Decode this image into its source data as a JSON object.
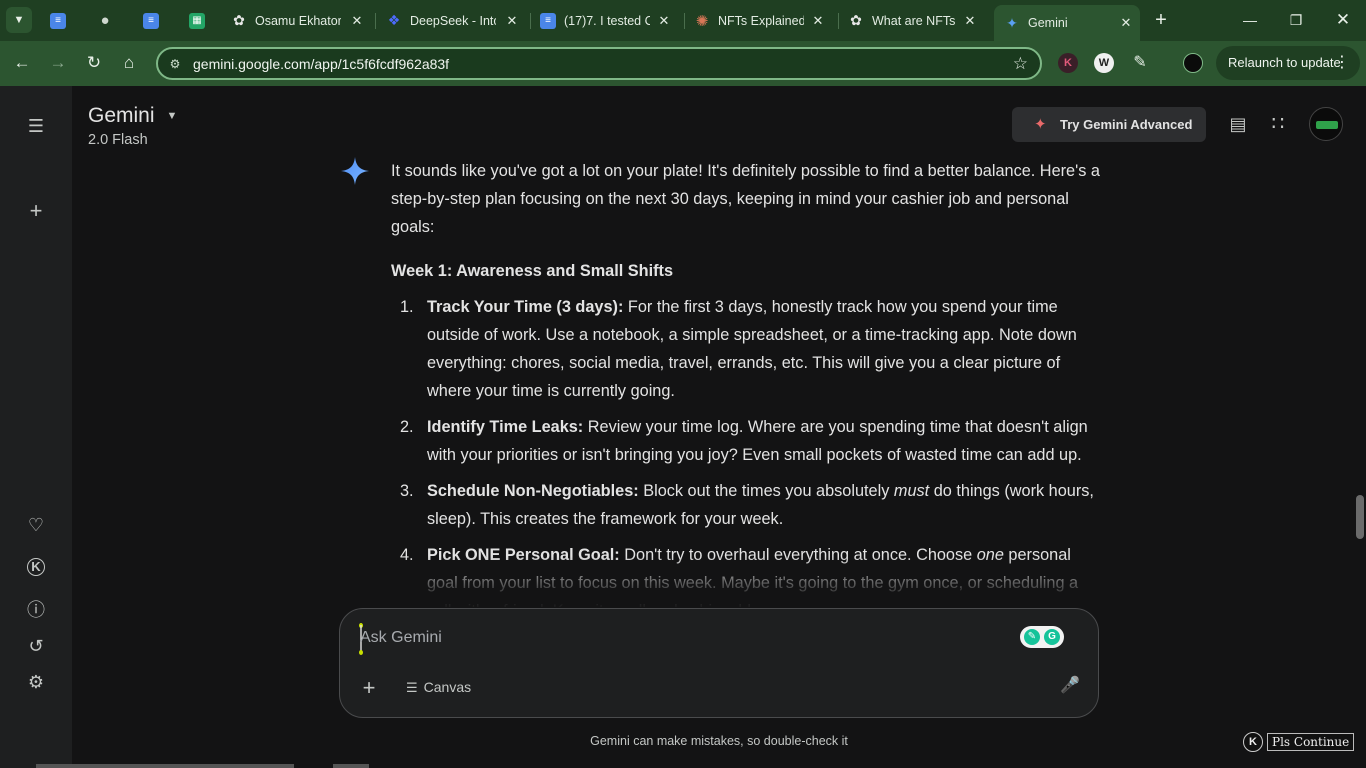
{
  "browser": {
    "tabs": [
      {
        "label": "",
        "favicon": "docs-icon",
        "color": "#4a86e8"
      },
      {
        "label": "",
        "favicon": "globe-icon",
        "color": "#8a9a8a"
      },
      {
        "label": "",
        "favicon": "docs-icon",
        "color": "#4a86e8"
      },
      {
        "label": "",
        "favicon": "sheets-icon",
        "color": "#23a566"
      },
      {
        "label": "Osamu Ekhator",
        "favicon": "chatgpt-icon",
        "color": "#e8e8e8"
      },
      {
        "label": "DeepSeek - Into",
        "favicon": "deepseek-icon",
        "color": "#4d6bfe"
      },
      {
        "label": "(17)7. I tested C",
        "favicon": "docs-icon",
        "color": "#4a86e8"
      },
      {
        "label": "NFTs Explained",
        "favicon": "claude-icon",
        "color": "#d97757"
      },
      {
        "label": "What are NFTs",
        "favicon": "chatgpt-icon",
        "color": "#e8e8e8"
      },
      {
        "label": "Gemini",
        "favicon": "gemini-icon",
        "color": "#4a90e2"
      }
    ],
    "url": "gemini.google.com/app/1c5f6fcdf962a83f",
    "relaunch_label": "Relaunch to update"
  },
  "header": {
    "brand": "Gemini",
    "model": "2.0 Flash",
    "advanced_label": "Try Gemini Advanced"
  },
  "response": {
    "intro": "It sounds like you've got a lot on your plate! It's definitely possible to find a better balance. Here's a step-by-step plan focusing on the next 30 days, keeping in mind your cashier job and personal goals:",
    "week_heading": "Week 1: Awareness and Small Shifts",
    "items": [
      {
        "num": "1.",
        "title": "Track Your Time (3 days):",
        "text": " For the first 3 days, honestly track how you spend your time outside of work. Use a notebook, a simple spreadsheet, or a time-tracking app. Note down everything: chores, social media, travel, errands, etc. This will give you a clear picture of where your time is currently going."
      },
      {
        "num": "2.",
        "title": "Identify Time Leaks:",
        "text": " Review your time log. Where are you spending time that doesn't align with your priorities or isn't bringing you joy? Even small pockets of wasted time can add up."
      },
      {
        "num": "3.",
        "title": "Schedule Non-Negotiables:",
        "text_before": " Block out the times you absolutely ",
        "emph": "must",
        "text_after": " do things (work hours, sleep). This creates the framework for your week."
      },
      {
        "num": "4.",
        "title": "Pick ONE Personal Goal:",
        "text_before": " Don't try to overhaul everything at once. Choose ",
        "emph": "one",
        "text_after": " personal goal from your list to focus on this week. Maybe it's going to the gym once, or scheduling a call with a friend. Keep it small and achievable."
      }
    ]
  },
  "input": {
    "placeholder": "Ask Gemini",
    "canvas_label": "Canvas"
  },
  "footer": {
    "disclaimer": "Gemini can make mistakes, so double-check it",
    "continue_label": "Pls Continue",
    "k_badge": "K"
  },
  "extensions": {
    "k_label": "K",
    "w_label": "W"
  }
}
